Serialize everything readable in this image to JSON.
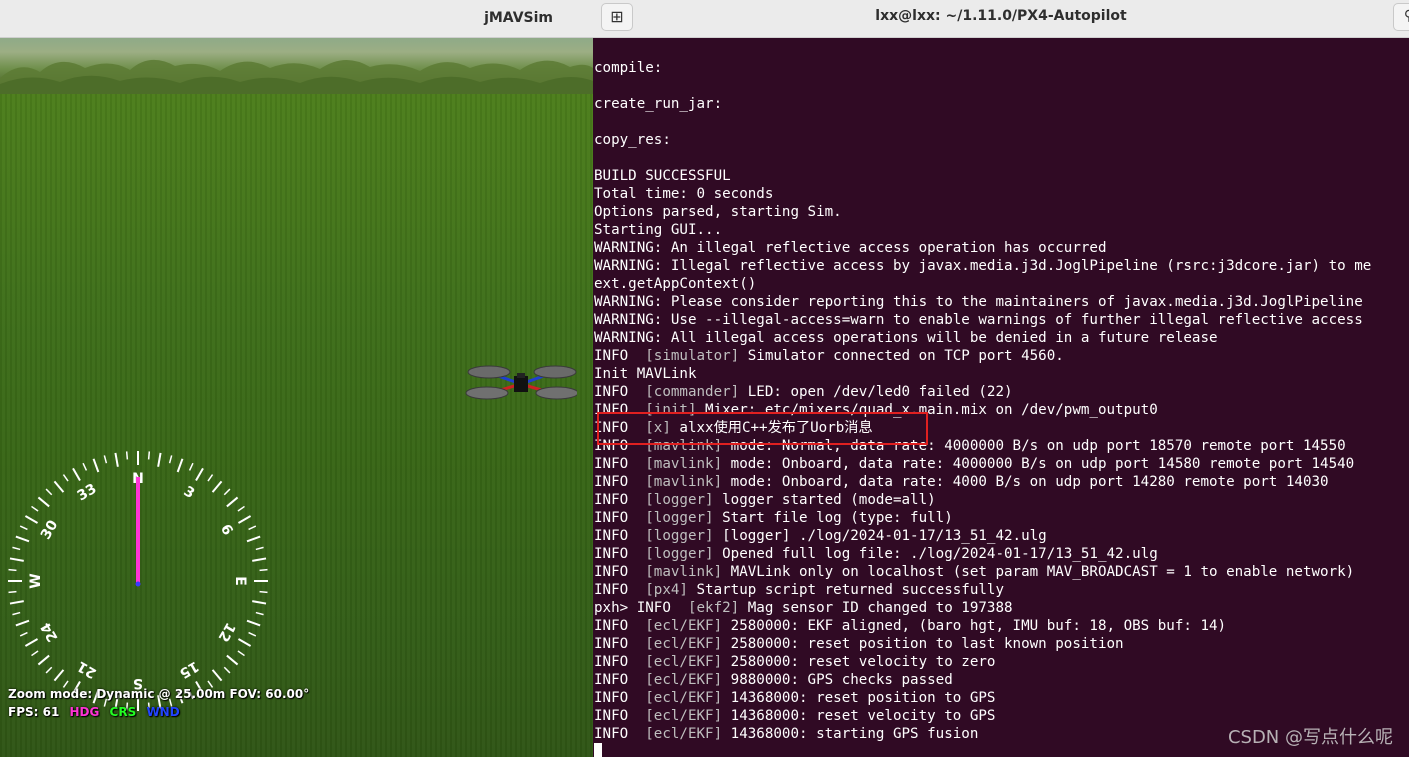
{
  "sim": {
    "title": "jMAVSim",
    "compass": {
      "heading_deg": 0,
      "labels": [
        {
          "text": "N",
          "angle": 0
        },
        {
          "text": "3",
          "angle": 30
        },
        {
          "text": "6",
          "angle": 60
        },
        {
          "text": "E",
          "angle": 90
        },
        {
          "text": "12",
          "angle": 120
        },
        {
          "text": "15",
          "angle": 150
        },
        {
          "text": "S",
          "angle": 180
        },
        {
          "text": "21",
          "angle": 210
        },
        {
          "text": "24",
          "angle": 240
        },
        {
          "text": "W",
          "angle": 270
        },
        {
          "text": "30",
          "angle": 300
        },
        {
          "text": "33",
          "angle": 330
        }
      ],
      "needle_color": "#ff33d6"
    },
    "hud": {
      "zoom_text": "Zoom mode: Dynamic @ 25.00m   FOV: 60.00°",
      "fps_text": "FPS:  61",
      "hdg_label": "HDG",
      "crs_label": "CRS",
      "wnd_label": "WND",
      "hdg_color": "#ff33d6",
      "crs_color": "#22ff22",
      "wnd_color": "#2244ff"
    }
  },
  "terminal": {
    "title": "lxx@lxx: ~/1.11.0/PX4-Autopilot",
    "newtab_icon": "new-tab-icon",
    "lines": [
      {
        "pre": "",
        "tag": "",
        "msg": ""
      },
      {
        "pre": "compile:",
        "tag": "",
        "msg": ""
      },
      {
        "pre": "",
        "tag": "",
        "msg": ""
      },
      {
        "pre": "create_run_jar:",
        "tag": "",
        "msg": ""
      },
      {
        "pre": "",
        "tag": "",
        "msg": ""
      },
      {
        "pre": "copy_res:",
        "tag": "",
        "msg": ""
      },
      {
        "pre": "",
        "tag": "",
        "msg": ""
      },
      {
        "pre": "BUILD SUCCESSFUL",
        "tag": "",
        "msg": ""
      },
      {
        "pre": "Total time: 0 seconds",
        "tag": "",
        "msg": ""
      },
      {
        "pre": "Options parsed, starting Sim.",
        "tag": "",
        "msg": ""
      },
      {
        "pre": "Starting GUI...",
        "tag": "",
        "msg": ""
      },
      {
        "pre": "WARNING: An illegal reflective access operation has occurred",
        "tag": "",
        "msg": ""
      },
      {
        "pre": "WARNING: Illegal reflective access by javax.media.j3d.JoglPipeline (rsrc:j3dcore.jar) to me",
        "tag": "",
        "msg": ""
      },
      {
        "pre": "ext.getAppContext()",
        "tag": "",
        "msg": ""
      },
      {
        "pre": "WARNING: Please consider reporting this to the maintainers of javax.media.j3d.JoglPipeline",
        "tag": "",
        "msg": ""
      },
      {
        "pre": "WARNING: Use --illegal-access=warn to enable warnings of further illegal reflective access",
        "tag": "",
        "msg": ""
      },
      {
        "pre": "WARNING: All illegal access operations will be denied in a future release",
        "tag": "",
        "msg": ""
      },
      {
        "pre": "INFO  ",
        "tag": "[simulator]",
        "msg": " Simulator connected on TCP port 4560."
      },
      {
        "pre": "Init MAVLink",
        "tag": "",
        "msg": ""
      },
      {
        "pre": "INFO  ",
        "tag": "[commander]",
        "msg": " LED: open /dev/led0 failed (22)"
      },
      {
        "pre": "INFO  ",
        "tag": "[init]",
        "msg": " Mixer: etc/mixers/quad_x.main.mix on /dev/pwm_output0"
      },
      {
        "pre": "INFO  ",
        "tag": "[x]",
        "msg": " alxx使用C++发布了Uorb消息"
      },
      {
        "pre": "INFO  ",
        "tag": "[mavlink]",
        "msg": " mode: Normal, data rate: 4000000 B/s on udp port 18570 remote port 14550"
      },
      {
        "pre": "INFO  ",
        "tag": "[mavlink]",
        "msg": " mode: Onboard, data rate: 4000000 B/s on udp port 14580 remote port 14540"
      },
      {
        "pre": "INFO  ",
        "tag": "[mavlink]",
        "msg": " mode: Onboard, data rate: 4000 B/s on udp port 14280 remote port 14030"
      },
      {
        "pre": "INFO  ",
        "tag": "[logger]",
        "msg": " logger started (mode=all)"
      },
      {
        "pre": "INFO  ",
        "tag": "[logger]",
        "msg": " Start file log (type: full)"
      },
      {
        "pre": "INFO  ",
        "tag": "[logger]",
        "msg": " [logger] ./log/2024-01-17/13_51_42.ulg"
      },
      {
        "pre": "INFO  ",
        "tag": "[logger]",
        "msg": " Opened full log file: ./log/2024-01-17/13_51_42.ulg"
      },
      {
        "pre": "INFO  ",
        "tag": "[mavlink]",
        "msg": " MAVLink only on localhost (set param MAV_BROADCAST = 1 to enable network)"
      },
      {
        "pre": "INFO  ",
        "tag": "[px4]",
        "msg": " Startup script returned successfully"
      },
      {
        "pre": "pxh> INFO  ",
        "tag": "[ekf2]",
        "msg": " Mag sensor ID changed to 197388"
      },
      {
        "pre": "INFO  ",
        "tag": "[ecl/EKF]",
        "msg": " 2580000: EKF aligned, (baro hgt, IMU buf: 18, OBS buf: 14)"
      },
      {
        "pre": "INFO  ",
        "tag": "[ecl/EKF]",
        "msg": " 2580000: reset position to last known position"
      },
      {
        "pre": "INFO  ",
        "tag": "[ecl/EKF]",
        "msg": " 2580000: reset velocity to zero"
      },
      {
        "pre": "INFO  ",
        "tag": "[ecl/EKF]",
        "msg": " 9880000: GPS checks passed"
      },
      {
        "pre": "INFO  ",
        "tag": "[ecl/EKF]",
        "msg": " 14368000: reset position to GPS"
      },
      {
        "pre": "INFO  ",
        "tag": "[ecl/EKF]",
        "msg": " 14368000: reset velocity to GPS"
      },
      {
        "pre": "INFO  ",
        "tag": "[ecl/EKF]",
        "msg": " 14368000: starting GPS fusion"
      }
    ],
    "highlight_color": "#e02020"
  },
  "watermark": "CSDN @写点什么呢"
}
